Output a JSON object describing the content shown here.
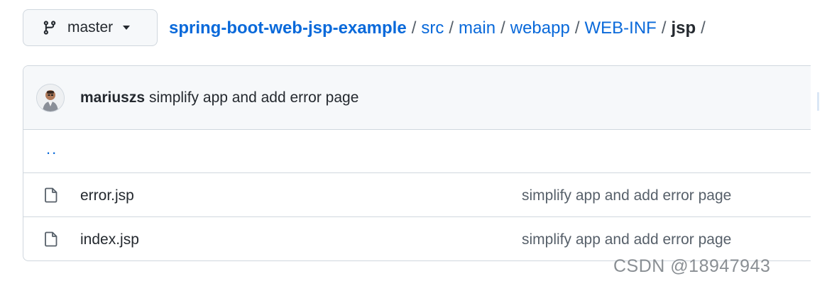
{
  "branch": {
    "icon": "git-branch-icon",
    "name": "master",
    "caret_icon": "caret-down-icon"
  },
  "breadcrumb": {
    "repo": "spring-boot-web-jsp-example",
    "segments": [
      "src",
      "main",
      "webapp",
      "WEB-INF"
    ],
    "separator": "/",
    "current": "jsp",
    "trailing_separator": "/"
  },
  "latest_commit": {
    "avatar_icon": "user-avatar",
    "author": "mariuszs",
    "message": "simplify app and add error page"
  },
  "parent_directory": {
    "label": ".."
  },
  "files": [
    {
      "icon": "file-icon",
      "name": "error.jsp",
      "commit_message": "simplify app and add error page"
    },
    {
      "icon": "file-icon",
      "name": "index.jsp",
      "commit_message": "simplify app and add error page"
    }
  ],
  "watermark": {
    "text": "CSDN @18947943"
  },
  "colors": {
    "link": "#0969da",
    "text": "#24292f",
    "muted": "#57606a",
    "border": "#d0d7de",
    "header_bg": "#f6f8fa"
  }
}
